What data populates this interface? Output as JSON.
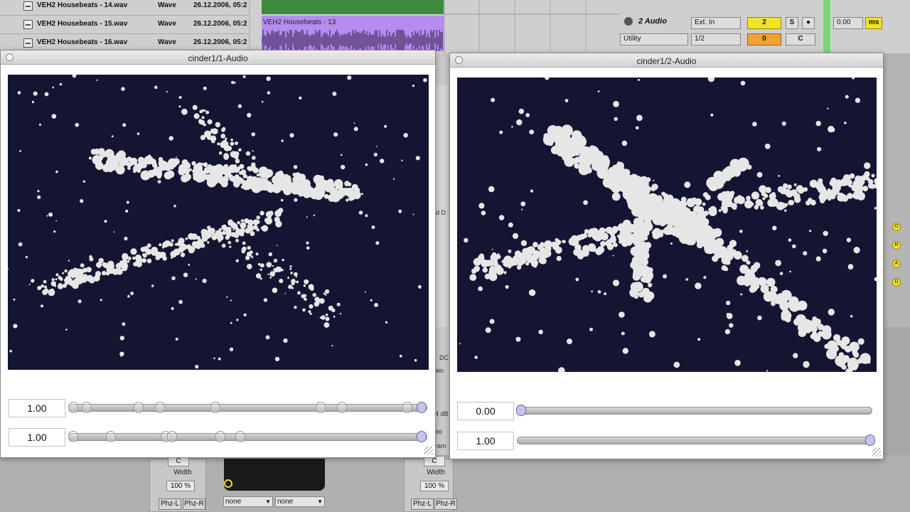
{
  "browser": {
    "files": [
      {
        "name": "VEH2 Housebeats - 14.wav",
        "type": "Wave",
        "date": "26.12.2006, 05:2"
      },
      {
        "name": "VEH2 Housebeats - 15.wav",
        "type": "Wave",
        "date": "26.12.2006, 05:2"
      },
      {
        "name": "VEH2 Housebeats - 16.wav",
        "type": "Wave",
        "date": "26.12.2006, 05:2"
      }
    ]
  },
  "arrangement": {
    "clip_title": "VEH2 Housebeats - 13",
    "add_symbol": "+"
  },
  "mixer": {
    "track_name": "2 Audio",
    "input_type": "Ext. In",
    "input_channel": "1/2",
    "device": "Utility",
    "track_number": "2",
    "sends_value": "0",
    "solo": "S",
    "arm": "●",
    "pan": "C",
    "delay_value": "0.00",
    "delay_unit": "ms",
    "side_buttons": [
      "O",
      "R",
      "A",
      "D"
    ]
  },
  "background_fragments": {
    "mid_text": "nd D",
    "dc_text": "DC",
    "gain_text": "ain",
    "db_text": "4 dB",
    "eo_text": "eo",
    "ram_text": "ram"
  },
  "devices": {
    "left": {
      "pan": "C",
      "width_label": "Width",
      "width_value": "100 %",
      "phz_l": "Phz-L",
      "phz_r": "Phz-R"
    },
    "right": {
      "pan": "C",
      "width_label": "Width",
      "width_value": "100 %",
      "phz_l": "Phz-L",
      "phz_r": "Phz-R"
    },
    "dropdown1": "none",
    "dropdown2": "none"
  },
  "windows": [
    {
      "title": "cinder1/1-Audio",
      "slider1_value": "1.00",
      "slider2_value": "1.00"
    },
    {
      "title": "cinder1/2-Audio",
      "slider1_value": "0.00",
      "slider2_value": "1.00"
    }
  ],
  "colors": {
    "canvas_bg": "#141433",
    "particle": "#e6e6e6",
    "clip_purple": "#b58cf0",
    "clip_green": "#3e8a3e",
    "mixer_yellow": "#f1e22a",
    "mixer_orange": "#f0a330"
  }
}
